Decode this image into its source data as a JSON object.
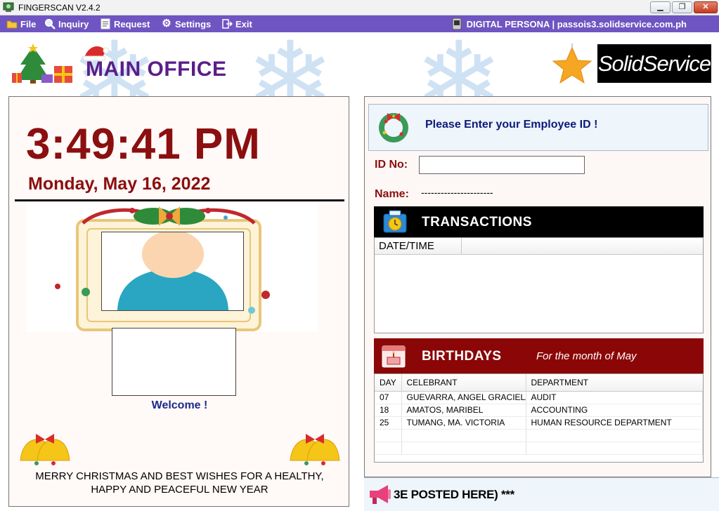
{
  "window": {
    "title": "FINGERSCAN V2.4.2",
    "minimize": "▁",
    "maximize": "❐",
    "close": "✕"
  },
  "menu": {
    "items": [
      {
        "label": "File",
        "icon": "folder-icon"
      },
      {
        "label": "Inquiry",
        "icon": "magnifier-icon"
      },
      {
        "label": "Request",
        "icon": "document-icon"
      },
      {
        "label": "Settings",
        "icon": "gear-icon"
      },
      {
        "label": "Exit",
        "icon": "exit-icon"
      }
    ],
    "device": "DIGITAL PERSONA | passois3.solidservice.com.ph"
  },
  "header": {
    "office": "MAIN OFFICE",
    "logo": "SolidService"
  },
  "clock": {
    "time": "3:49:41 PM",
    "date": "Monday, May 16, 2022"
  },
  "welcome": "Welcome !",
  "greeting": {
    "line1": "MERRY CHRISTMAS AND BEST WISHES FOR A HEALTHY,",
    "line2": "HAPPY AND PEACEFUL NEW YEAR"
  },
  "prompt": "Please Enter your Employee ID !",
  "form": {
    "id_label": "ID No:",
    "id_value": "",
    "name_label": "Name:",
    "name_value": "----------------------"
  },
  "transactions": {
    "title": "TRANSACTIONS",
    "columns": [
      "DATE/TIME",
      ""
    ]
  },
  "birthdays": {
    "title": "BIRTHDAYS",
    "subtitle": "For the month of May",
    "columns": [
      "DAY",
      "CELEBRANT",
      "DEPARTMENT"
    ],
    "rows": [
      {
        "day": "07",
        "celebrant": "GUEVARRA, ANGEL GRACIELA",
        "department": "AUDIT"
      },
      {
        "day": "18",
        "celebrant": "AMATOS, MARIBEL",
        "department": "ACCOUNTING"
      },
      {
        "day": "25",
        "celebrant": "TUMANG, MA. VICTORIA",
        "department": "HUMAN RESOURCE DEPARTMENT"
      }
    ]
  },
  "ticker": "3E POSTED HERE) ***",
  "colors": {
    "menu_bar": "#6e55c2",
    "clock": "#8b0f0f",
    "office": "#5a1e8a",
    "birthday_header": "#8b0606"
  }
}
